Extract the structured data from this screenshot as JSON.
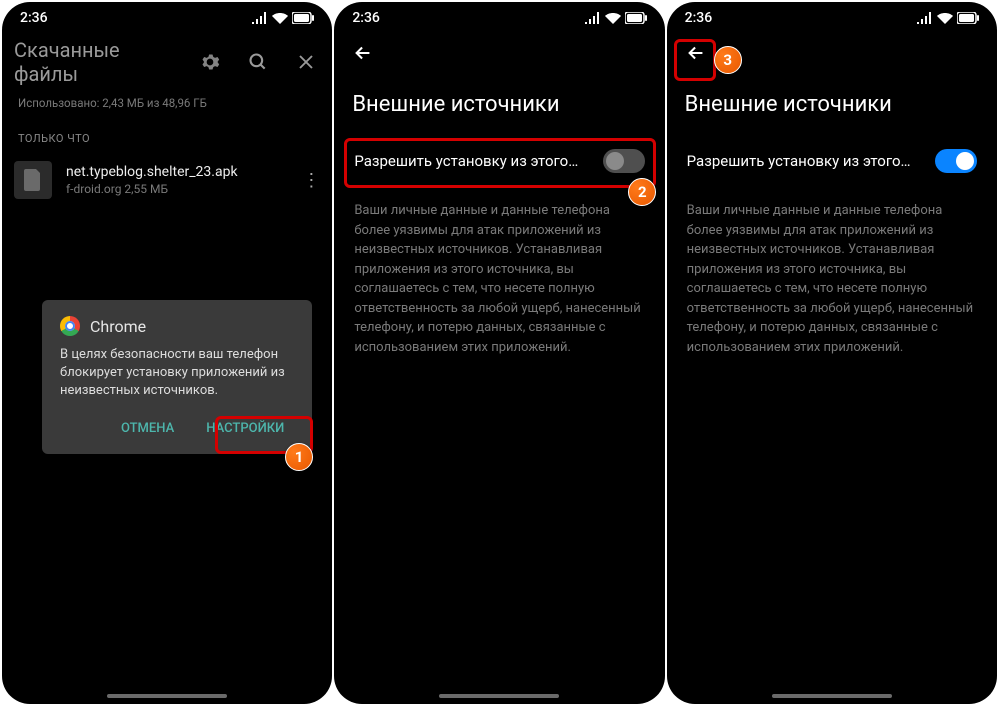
{
  "status": {
    "time": "2:36"
  },
  "p1": {
    "title": "Скачанные файлы",
    "storage": "Использовано: 2,43 МБ из 48,96 ГБ",
    "section": "ТОЛЬКО ЧТО",
    "file": {
      "name": "net.typeblog.shelter_23.apk",
      "meta": "f-droid.org 2,55 МБ"
    },
    "dialog": {
      "title": "Chrome",
      "body": "В целях безопасности ваш телефон блокирует установку приложений из неизвестных источников.",
      "cancel": "ОТМЕНА",
      "settings": "НАСТРОЙКИ"
    }
  },
  "p2": {
    "title": "Внешние источники",
    "toggle_label": "Разрешить установку из этого…",
    "warn": "Ваши личные данные и данные телефона более уязвимы для атак приложений из неизвестных источников. Устанавливая приложения из этого источника, вы соглашаетесь с тем, что несете полную ответственность за любой ущерб, нанесенный телефону, и потерю данных, связанные с использованием этих приложений."
  },
  "p3": {
    "title": "Внешние источники",
    "toggle_label": "Разрешить установку из этого…",
    "warn": "Ваши личные данные и данные телефона более уязвимы для атак приложений из неизвестных источников. Устанавливая приложения из этого источника, вы соглашаетесь с тем, что несете полную ответственность за любой ущерб, нанесенный телефону, и потерю данных, связанные с использованием этих приложений."
  },
  "badges": {
    "b1": "1",
    "b2": "2",
    "b3": "3"
  }
}
